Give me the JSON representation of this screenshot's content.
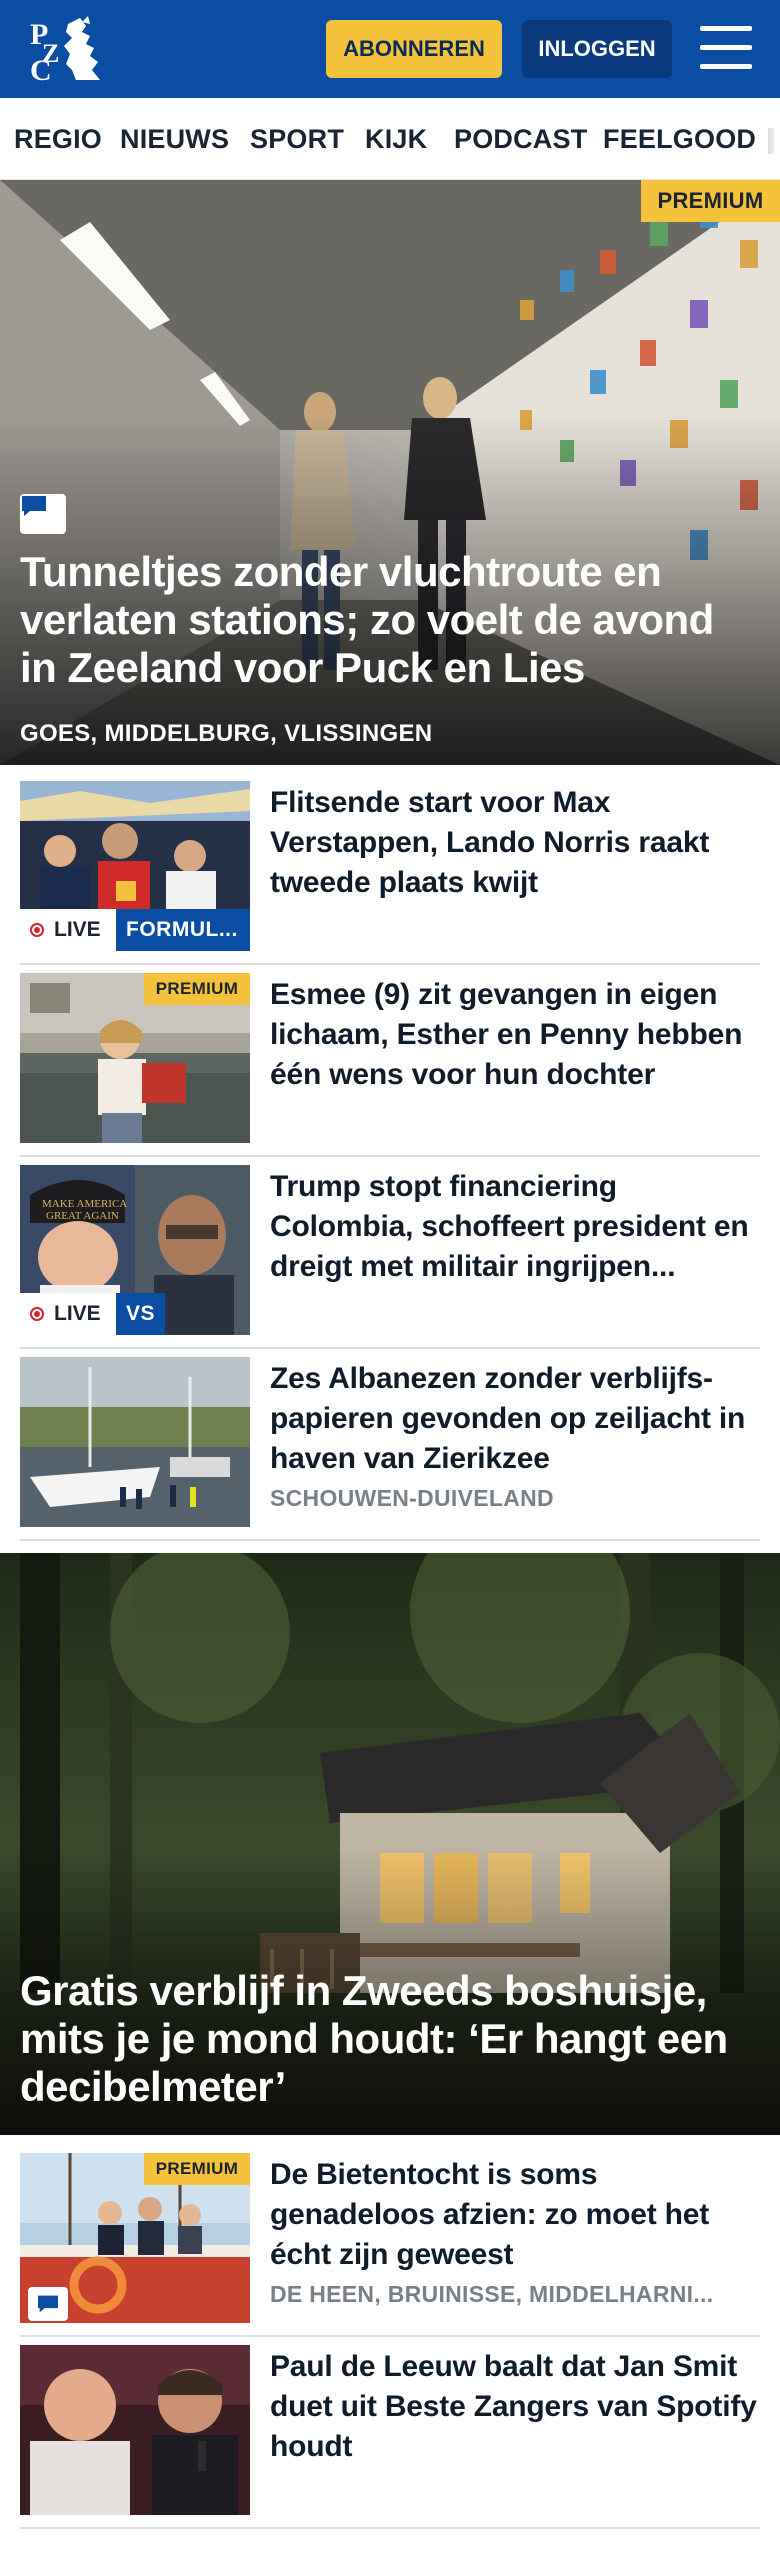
{
  "header": {
    "logo_text": "PZC",
    "subscribe_label": "ABONNEREN",
    "login_label": "INLOGGEN",
    "menu_icon": "hamburger-icon",
    "brand_color": "#0b4da2",
    "accent_color": "#f5c33b"
  },
  "nav": {
    "items": [
      "REGIO",
      "NIEUWS",
      "SPORT",
      "KIJK",
      "PODCAST",
      "FEELGOOD"
    ]
  },
  "hero": {
    "badge": "PREMIUM",
    "icon": "comment-icon",
    "title": "Tunneltjes zonder vluchtroute en verlaten stations; zo voelt de avond in Zeeland voor Puck en Lies",
    "location": "GOES, MIDDELBURG, VLISSINGEN"
  },
  "articles": [
    {
      "title": "Flitsende start voor Max Verstappen, Lando Norris raakt tweede plaats kwijt",
      "live": "LIVE",
      "category": "FORMUL..."
    },
    {
      "title": "Esmee (9) zit gevangen in eigen lichaam, Esther en Penny hebben één wens voor hun dochter",
      "badge": "PREMIUM"
    },
    {
      "title": "Trump stopt financiering Colombia, schoffeert president en dreigt met militair ingrijpen...",
      "live": "LIVE",
      "category": "VS"
    },
    {
      "title": "Zes Albanezen zonder verblijfs- papieren gevonden op zeiljacht in haven van Zierikzee",
      "location": "SCHOUWEN-DUIVELAND"
    }
  ],
  "hero2": {
    "title": "Gratis verblijf in Zweeds boshuisje, mits je je mond houdt: ‘Er hangt een decibelmeter’"
  },
  "articles2": [
    {
      "title": "De Bietentocht is soms genadeloos afzien: zo moet het écht zijn geweest",
      "badge": "PREMIUM",
      "location": "DE HEEN, BRUINISSE, MIDDELHARNI..."
    },
    {
      "title": "Paul de Leeuw baalt dat Jan Smit duet uit Beste Zangers van Spotify houdt"
    }
  ]
}
